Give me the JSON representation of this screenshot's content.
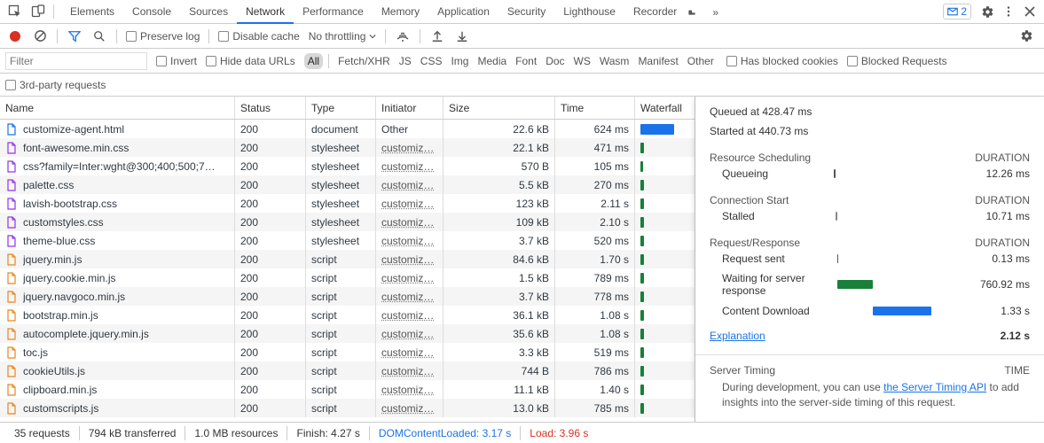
{
  "tabs": {
    "items": [
      "Elements",
      "Console",
      "Sources",
      "Network",
      "Performance",
      "Memory",
      "Application",
      "Security",
      "Lighthouse",
      "Recorder"
    ],
    "selected": 3,
    "more": "»",
    "messages_count": "2"
  },
  "toolbar": {
    "preserve": "Preserve log",
    "disable": "Disable cache",
    "throttle": "No throttling"
  },
  "filter": {
    "placeholder": "Filter",
    "invert": "Invert",
    "hidedata": "Hide data URLs",
    "chips": [
      "All",
      "Fetch/XHR",
      "JS",
      "CSS",
      "Img",
      "Media",
      "Font",
      "Doc",
      "WS",
      "Wasm",
      "Manifest",
      "Other"
    ],
    "chip_sel": 0,
    "blockedcookies": "Has blocked cookies",
    "blockedreq": "Blocked Requests",
    "thirdparty": "3rd-party requests"
  },
  "headers": {
    "name": "Name",
    "status": "Status",
    "type": "Type",
    "initiator": "Initiator",
    "size": "Size",
    "time": "Time",
    "waterfall": "Waterfall"
  },
  "rows": [
    {
      "icon": "doc",
      "ic": "#1a73e8",
      "name": "customize-agent.html",
      "status": "200",
      "type": "document",
      "initiator": "Other",
      "init_link": false,
      "size": "22.6 kB",
      "time": "624 ms",
      "wf": "#1a73e8",
      "wfw": 38,
      "wfx": 0
    },
    {
      "icon": "css",
      "ic": "#9334e6",
      "name": "font-awesome.min.css",
      "status": "200",
      "type": "stylesheet",
      "initiator": "customiz…",
      "init_link": true,
      "size": "22.1 kB",
      "time": "471 ms",
      "wf": "#188038",
      "wfw": 4,
      "wfx": 0
    },
    {
      "icon": "css",
      "ic": "#9334e6",
      "name": "css?family=Inter:wght@300;400;500;7…",
      "status": "200",
      "type": "stylesheet",
      "initiator": "customiz…",
      "init_link": true,
      "size": "570 B",
      "time": "105 ms",
      "wf": "#188038",
      "wfw": 3,
      "wfx": 0
    },
    {
      "icon": "css",
      "ic": "#9334e6",
      "name": "palette.css",
      "status": "200",
      "type": "stylesheet",
      "initiator": "customiz…",
      "init_link": true,
      "size": "5.5 kB",
      "time": "270 ms",
      "wf": "#188038",
      "wfw": 4,
      "wfx": 0
    },
    {
      "icon": "css",
      "ic": "#9334e6",
      "name": "lavish-bootstrap.css",
      "status": "200",
      "type": "stylesheet",
      "initiator": "customiz…",
      "init_link": true,
      "size": "123 kB",
      "time": "2.11 s",
      "wf": "#188038",
      "wfw": 4,
      "wfx": 0
    },
    {
      "icon": "css",
      "ic": "#9334e6",
      "name": "customstyles.css",
      "status": "200",
      "type": "stylesheet",
      "initiator": "customiz…",
      "init_link": true,
      "size": "109 kB",
      "time": "2.10 s",
      "wf": "#188038",
      "wfw": 4,
      "wfx": 0
    },
    {
      "icon": "css",
      "ic": "#9334e6",
      "name": "theme-blue.css",
      "status": "200",
      "type": "stylesheet",
      "initiator": "customiz…",
      "init_link": true,
      "size": "3.7 kB",
      "time": "520 ms",
      "wf": "#188038",
      "wfw": 4,
      "wfx": 0
    },
    {
      "icon": "js",
      "ic": "#e8871e",
      "name": "jquery.min.js",
      "status": "200",
      "type": "script",
      "initiator": "customiz…",
      "init_link": true,
      "size": "84.6 kB",
      "time": "1.70 s",
      "wf": "#188038",
      "wfw": 4,
      "wfx": 0
    },
    {
      "icon": "js",
      "ic": "#e8871e",
      "name": "jquery.cookie.min.js",
      "status": "200",
      "type": "script",
      "initiator": "customiz…",
      "init_link": true,
      "size": "1.5 kB",
      "time": "789 ms",
      "wf": "#188038",
      "wfw": 4,
      "wfx": 0
    },
    {
      "icon": "js",
      "ic": "#e8871e",
      "name": "jquery.navgoco.min.js",
      "status": "200",
      "type": "script",
      "initiator": "customiz…",
      "init_link": true,
      "size": "3.7 kB",
      "time": "778 ms",
      "wf": "#188038",
      "wfw": 4,
      "wfx": 0
    },
    {
      "icon": "js",
      "ic": "#e8871e",
      "name": "bootstrap.min.js",
      "status": "200",
      "type": "script",
      "initiator": "customiz…",
      "init_link": true,
      "size": "36.1 kB",
      "time": "1.08 s",
      "wf": "#188038",
      "wfw": 4,
      "wfx": 0
    },
    {
      "icon": "js",
      "ic": "#e8871e",
      "name": "autocomplete.jquery.min.js",
      "status": "200",
      "type": "script",
      "initiator": "customiz…",
      "init_link": true,
      "size": "35.6 kB",
      "time": "1.08 s",
      "wf": "#188038",
      "wfw": 4,
      "wfx": 0
    },
    {
      "icon": "js",
      "ic": "#e8871e",
      "name": "toc.js",
      "status": "200",
      "type": "script",
      "initiator": "customiz…",
      "init_link": true,
      "size": "3.3 kB",
      "time": "519 ms",
      "wf": "#188038",
      "wfw": 4,
      "wfx": 0
    },
    {
      "icon": "js",
      "ic": "#e8871e",
      "name": "cookieUtils.js",
      "status": "200",
      "type": "script",
      "initiator": "customiz…",
      "init_link": true,
      "size": "744 B",
      "time": "786 ms",
      "wf": "#188038",
      "wfw": 4,
      "wfx": 0
    },
    {
      "icon": "js",
      "ic": "#e8871e",
      "name": "clipboard.min.js",
      "status": "200",
      "type": "script",
      "initiator": "customiz…",
      "init_link": true,
      "size": "11.1 kB",
      "time": "1.40 s",
      "wf": "#188038",
      "wfw": 4,
      "wfx": 0
    },
    {
      "icon": "js",
      "ic": "#e8871e",
      "name": "customscripts.js",
      "status": "200",
      "type": "script",
      "initiator": "customiz…",
      "init_link": true,
      "size": "13.0 kB",
      "time": "785 ms",
      "wf": "#188038",
      "wfw": 4,
      "wfx": 0
    }
  ],
  "panel": {
    "queued": "Queued at 428.47 ms",
    "started": "Started at 440.73 ms",
    "sec_sched": "Resource Scheduling",
    "sec_conn": "Connection Start",
    "sec_req": "Request/Response",
    "dur": "DURATION",
    "time_hdr": "TIME",
    "queueing_lbl": "Queueing",
    "queueing_val": "12.26 ms",
    "stalled_lbl": "Stalled",
    "stalled_val": "10.71 ms",
    "reqsent_lbl": "Request sent",
    "reqsent_val": "0.13 ms",
    "waiting_lbl": "Waiting for server response",
    "waiting_val": "760.92 ms",
    "download_lbl": "Content Download",
    "download_val": "1.33 s",
    "explain": "Explanation",
    "total": "2.12 s",
    "server_hdr": "Server Timing",
    "server_desc1": "During development, you can use ",
    "server_link": "the Server Timing API",
    "server_desc2": " to add insights into the server-side timing of this request."
  },
  "footer": {
    "reqs": "35 requests",
    "xfer": "794 kB transferred",
    "res": "1.0 MB resources",
    "finish": "Finish: 4.27 s",
    "dcl": "DOMContentLoaded: 3.17 s",
    "load": "Load: 3.96 s"
  }
}
